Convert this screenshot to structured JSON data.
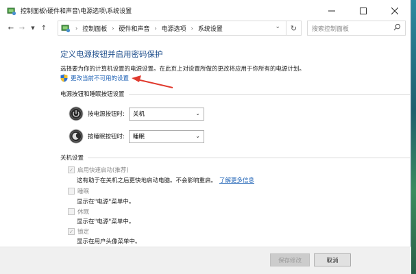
{
  "window": {
    "title": "控制面板\\硬件和声音\\电源选项\\系统设置",
    "minimize_icon": "minimize-icon",
    "maximize_icon": "maximize-icon",
    "close_icon": "close-icon"
  },
  "nav": {
    "breadcrumb": [
      "控制面板",
      "硬件和声音",
      "电源选项",
      "系统设置"
    ],
    "search_placeholder": "搜索控制面板"
  },
  "page": {
    "heading": "定义电源按钮并启用密码保护",
    "description": "选择要为你的计算机设置的电源设置。在此页上对设置所做的更改将应用于你所有的电源计划。",
    "change_link": "更改当前不可用的设置"
  },
  "power_section": {
    "title": "电源按钮和睡眠按钮设置",
    "power_button_label": "按电源按钮时:",
    "power_button_value": "关机",
    "sleep_button_label": "按睡眠按钮时:",
    "sleep_button_value": "睡眠"
  },
  "shutdown_section": {
    "title": "关机设置",
    "items": [
      {
        "label": "启用快速启动(推荐)",
        "checked": true,
        "desc": "这有助于在关机之后更快地启动电脑。不会影响重启。",
        "link": "了解更多信息"
      },
      {
        "label": "睡眠",
        "checked": false,
        "desc": "显示在\"电源\"菜单中。"
      },
      {
        "label": "休眠",
        "checked": false,
        "desc": "显示在\"电源\"菜单中。"
      },
      {
        "label": "锁定",
        "checked": true,
        "desc": "显示在用户头像菜单中。"
      }
    ]
  },
  "footer": {
    "save_label": "保存修改",
    "cancel_label": "取消"
  },
  "colors": {
    "heading": "#1e4e8c",
    "link": "#1a5fb4",
    "annotation_arrow": "#e03a2e"
  }
}
